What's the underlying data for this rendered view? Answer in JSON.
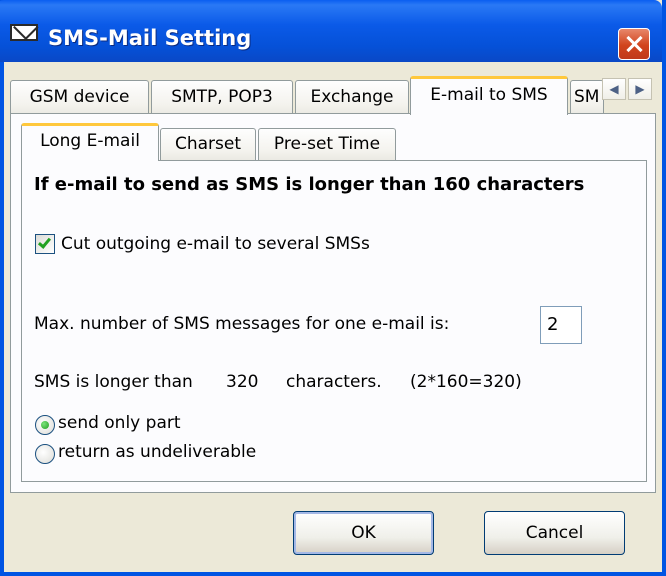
{
  "window": {
    "title": "SMS-Mail Setting",
    "icon": "mail-envelope-icon"
  },
  "outer_tabs": [
    {
      "label": "GSM device"
    },
    {
      "label": "SMTP, POP3"
    },
    {
      "label": "Exchange"
    },
    {
      "label": "E-mail to SMS"
    },
    {
      "label": "SM"
    }
  ],
  "outer_tab_scroll": {
    "left": "◀",
    "right": "▶"
  },
  "inner_tabs": [
    {
      "label": "Long E-mail"
    },
    {
      "label": "Charset"
    },
    {
      "label": "Pre-set Time"
    }
  ],
  "long_email": {
    "heading": "If e-mail to send as SMS is longer than 160 characters",
    "cut_checkbox_label": "Cut outgoing e-mail to several SMSs",
    "cut_checked": true,
    "max_label": "Max. number of SMS messages for one e-mail is:",
    "max_value": "2",
    "longer_prefix": "SMS is longer than",
    "longer_count": "320",
    "longer_suffix": "characters.",
    "longer_formula": "(2*160=320)",
    "radio_send_part": "send only part",
    "radio_return": "return as undeliverable",
    "selected_option": "send only part"
  },
  "buttons": {
    "ok": "OK",
    "cancel": "Cancel"
  },
  "colors": {
    "titlebar": "#0054e3",
    "active_tab_highlight": "#ffc83c",
    "checkmark": "#21a121",
    "close_button": "#d1441c"
  }
}
